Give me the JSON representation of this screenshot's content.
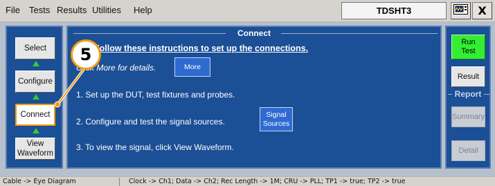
{
  "menu": {
    "items": [
      "File",
      "Tests",
      "Results",
      "Utilities",
      "Help"
    ],
    "app_title": "TDSHT3",
    "scope_icon": "scope-display-icon",
    "close_label": "X"
  },
  "nav": {
    "buttons": [
      {
        "label": "Select",
        "active": false
      },
      {
        "label": "Configure",
        "active": false
      },
      {
        "label": "Connect",
        "active": true
      },
      {
        "label": "View Waveform",
        "active": false
      }
    ],
    "view_line1": "View",
    "view_line2": "Waveform"
  },
  "panel": {
    "title": "Connect",
    "instructions_header": "Follow these instructions to set up the connections.",
    "more_prompt": "Click More for details.",
    "more_button": "More",
    "steps": [
      "1. Set up the DUT, test fixtures and probes.",
      "2. Configure and test the signal sources.",
      "3. To view the signal, click View Waveform."
    ],
    "signal_sources_line1": "Signal",
    "signal_sources_line2": "Sources"
  },
  "callout": {
    "number": "5"
  },
  "right": {
    "run_line1": "Run",
    "run_line2": "Test",
    "result": "Result",
    "report_label": "Report",
    "summary": "Summary",
    "detail": "Detail"
  },
  "status": {
    "left": "Cable -> Eye Diagram",
    "right": "Clock -> Ch1; Data -> Ch2; Rec Length -> 1M; CRU -> PLL; TP1 -> true; TP2 -> true"
  },
  "colors": {
    "panel_blue": "#1b4f96",
    "run_green": "#33ee33",
    "active_border": "#ff9800",
    "callout_orange": "#f39c12"
  }
}
